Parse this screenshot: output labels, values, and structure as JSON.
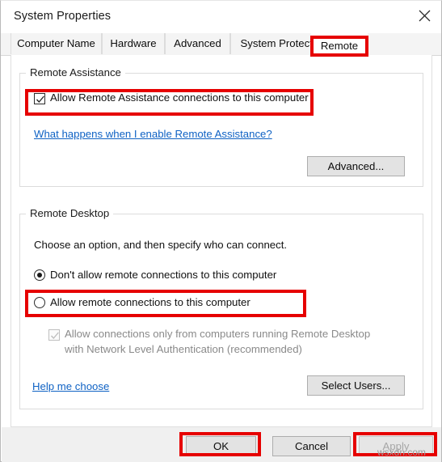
{
  "window": {
    "title": "System Properties",
    "close_icon": "close-icon"
  },
  "tabs": [
    {
      "label": "Computer Name",
      "active": false
    },
    {
      "label": "Hardware",
      "active": false
    },
    {
      "label": "Advanced",
      "active": false
    },
    {
      "label": "System Protection",
      "active": false
    },
    {
      "label": "Remote",
      "active": true
    }
  ],
  "remote_assistance": {
    "group_label": "Remote Assistance",
    "checkbox": {
      "label": "Allow Remote Assistance connections to this computer",
      "checked": true
    },
    "link": "What happens when I enable Remote Assistance?",
    "advanced_button": "Advanced..."
  },
  "remote_desktop": {
    "group_label": "Remote Desktop",
    "instruction": "Choose an option, and then specify who can connect.",
    "options": [
      {
        "label": "Don't allow remote connections to this computer",
        "selected": true
      },
      {
        "label": "Allow remote connections to this computer",
        "selected": false
      }
    ],
    "nla_checkbox": {
      "line1": "Allow connections only from computers running Remote Desktop",
      "line2": "with Network Level Authentication (recommended)",
      "checked": true,
      "disabled": true
    },
    "help_link": "Help me choose",
    "select_users_button": "Select Users..."
  },
  "footer": {
    "ok_button": "OK",
    "cancel_button": "Cancel",
    "apply_button": "Apply",
    "apply_disabled": true
  },
  "watermark": "wsxdn.com",
  "colors": {
    "annotation_red": "#e60000",
    "link_blue": "#0f62c4",
    "dialog_bg": "#ffffff",
    "footer_bg": "#f0f0f0",
    "button_face": "#e3e3e3"
  }
}
